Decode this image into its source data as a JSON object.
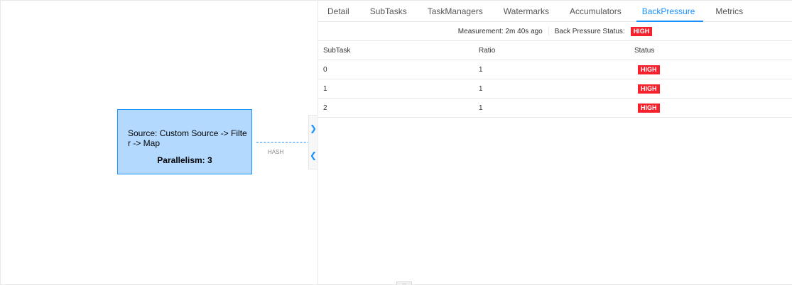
{
  "graph": {
    "node": {
      "name": "Source: Custom Source -> Filter -> Map",
      "parallelism": "Parallelism: 3"
    },
    "edge_label": "HASH",
    "collapse_icons": [
      "chevron-right-icon",
      "chevron-left-icon"
    ]
  },
  "tabs": [
    {
      "label": "Detail"
    },
    {
      "label": "SubTasks"
    },
    {
      "label": "TaskManagers"
    },
    {
      "label": "Watermarks"
    },
    {
      "label": "Accumulators"
    },
    {
      "label": "BackPressure",
      "active": true
    },
    {
      "label": "Metrics"
    }
  ],
  "backpressure": {
    "measurement_label": "Measurement: 2m 40s ago",
    "status_label": "Back Pressure Status:",
    "status_value": "HIGH",
    "columns": [
      "SubTask",
      "Ratio",
      "Status"
    ],
    "rows": [
      {
        "subtask": "0",
        "ratio": "1",
        "status": "HIGH"
      },
      {
        "subtask": "1",
        "ratio": "1",
        "status": "HIGH"
      },
      {
        "subtask": "2",
        "ratio": "1",
        "status": "HIGH"
      }
    ]
  },
  "colors": {
    "accent": "#1890ff",
    "node_fill": "#b3d9ff",
    "status_high": "#f5222d"
  }
}
